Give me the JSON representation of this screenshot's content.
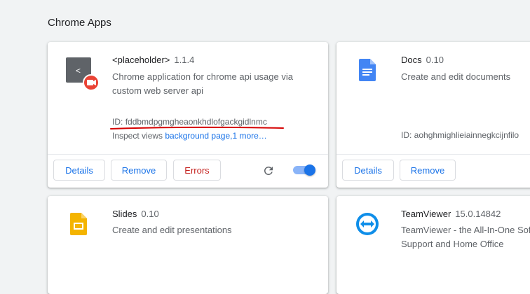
{
  "section": {
    "title": "Chrome Apps"
  },
  "cards": [
    {
      "name": "<placeholder>",
      "version": "1.1.4",
      "description_line1": "Chrome application for chrome api usage via",
      "description_line2": "custom web server api",
      "id_label": "ID:",
      "id_value": "fddbmdpgmgheaonkhdlofgackgidlnmc",
      "inspect_label": "Inspect views",
      "inspect_link": "background page,1 more…",
      "buttons": {
        "details": "Details",
        "remove": "Remove",
        "errors": "Errors"
      },
      "enabled": true
    },
    {
      "name": "Docs",
      "version": "0.10",
      "description": "Create and edit documents",
      "id_text": "ID: aohghmighlieiainnegkcijnfilo",
      "buttons": {
        "details": "Details",
        "remove": "Remove"
      }
    },
    {
      "name": "Slides",
      "version": "0.10",
      "description": "Create and edit presentations"
    },
    {
      "name": "TeamViewer",
      "version": "15.0.14842",
      "description_line1": "TeamViewer - the All-In-One Sof",
      "description_line2": "Support and Home Office"
    }
  ],
  "colors": {
    "accent": "#1a73e8",
    "error": "#c5221f",
    "toggle_track": "#8ab4f8",
    "annotation_underline": "#d50000",
    "slides_yellow": "#f4b400",
    "docs_blue": "#4285f4",
    "teamviewer_blue": "#0e8ee9"
  }
}
